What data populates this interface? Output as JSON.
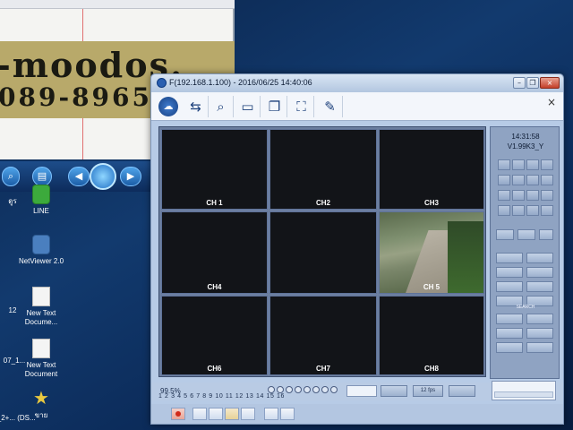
{
  "window": {
    "title": "F(192.168.1.100) - 2016/06/25 14:40:06",
    "close_glyph": "×",
    "restore_glyph": "❐",
    "minimize_glyph": "–"
  },
  "toolbar": {
    "icons": [
      "network-icon",
      "monitor-icon",
      "search-icon",
      "display-icon",
      "copy-icon",
      "fullscreen-icon",
      "edit-icon"
    ],
    "close_glyph": "×"
  },
  "channels": [
    "CH 1",
    "CH2",
    "CH3",
    "CH4",
    "",
    "CH 5",
    "CH6",
    "CH7",
    "CH8"
  ],
  "panel": {
    "time": "14:31:58",
    "version": "V1.99K3_Y",
    "search_label": "SEARCH"
  },
  "status": {
    "percent": "99.5%",
    "channel_numbers": "1  2  3  4  5  6  7  8  9  10 11 12 13 14 15 16",
    "fps": "12 fps"
  },
  "desktop": {
    "icons": [
      {
        "label": "LINE"
      },
      {
        "label": "NetViewer 2.0"
      },
      {
        "label": "New Text Docume..."
      },
      {
        "label": "New Text Document"
      },
      {
        "label": "ขาย"
      }
    ],
    "left_labels": [
      "ดูร",
      "12",
      "07_1...",
      "2_2+... (DS..."
    ],
    "paper_line1": "-moodos.",
    "paper_line2": "089-8965"
  }
}
